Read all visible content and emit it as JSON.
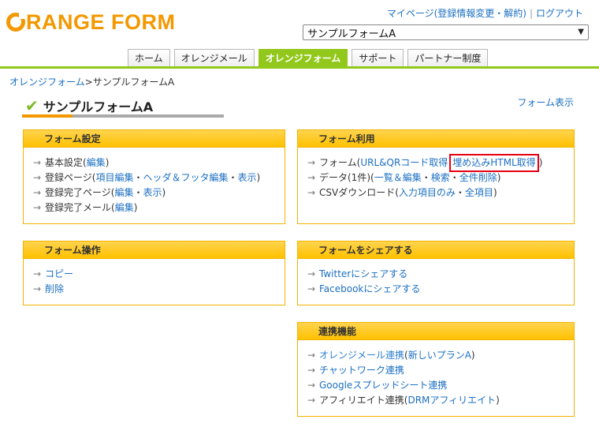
{
  "logo": {
    "text": "RANGE FORM"
  },
  "toplinks": {
    "mypage": "マイページ(登録情報変更・解約)",
    "sep": "|",
    "logout": "ログアウト"
  },
  "form_select": {
    "value": "サンプルフォームA"
  },
  "nav": {
    "tabs": [
      "ホーム",
      "オレンジメール",
      "オレンジフォーム",
      "サポート",
      "パートナー制度"
    ],
    "active_index": 2
  },
  "breadcrumb": {
    "root": "オレンジフォーム",
    "sep": ">",
    "current": "サンプルフォームA"
  },
  "page": {
    "title": "サンプルフォームA",
    "view_link": "フォーム表示"
  },
  "panels": {
    "form_settings": {
      "title": "フォーム設定",
      "rows": [
        {
          "label": "基本設定",
          "open": " (",
          "links": [
            "編集"
          ],
          "close": ")"
        },
        {
          "label": "登録ページ",
          "open": " (",
          "links": [
            "項目編集",
            "ヘッダ＆フッタ編集",
            "表示"
          ],
          "close": ")"
        },
        {
          "label": "登録完了ページ",
          "open": " (",
          "links": [
            "編集",
            "表示"
          ],
          "close": ")"
        },
        {
          "label": "登録完了メール",
          "open": " (",
          "links": [
            "編集"
          ],
          "close": ")"
        }
      ]
    },
    "form_usage": {
      "title": "フォーム利用",
      "row1": {
        "label": "フォーム(",
        "link1": "URL&QRコード取得",
        "link2": "埋め込みHTML取得",
        "close": ")"
      },
      "row2": {
        "label": "データ(1件)",
        "open": " (",
        "link1": "一覧＆編集",
        "link2": "検索",
        "link3": "全件削除",
        "close": ")"
      },
      "row3": {
        "label": "CSVダウンロード(",
        "link1": "入力項目のみ",
        "link2": "全項目",
        "close": ")"
      }
    },
    "form_ops": {
      "title": "フォーム操作",
      "items": [
        "コピー",
        "削除"
      ]
    },
    "share": {
      "title": "フォームをシェアする",
      "items": [
        "Twitterにシェアする",
        "Facebookにシェアする"
      ]
    },
    "integrations": {
      "title": "連携機能",
      "row1": {
        "link1": "オレンジメール連携",
        "open": " (",
        "link2": "新しいプランA",
        "close": ")"
      },
      "row2": {
        "link": "チャットワーク連携"
      },
      "row3": {
        "link": "Googleスプレッドシート連携"
      },
      "row4": {
        "label": "アフィリエイト連携(",
        "link": "DRMアフィリエイト",
        "close": ")"
      }
    }
  },
  "glyphs": {
    "arrow": "→",
    "dot": "・",
    "check": "✔",
    "chevron": "⌄"
  },
  "colors": {
    "brand_orange": "#f39800",
    "nav_green": "#92c81c",
    "panel_yellow": "#ffc100",
    "link_blue": "#1b6fc2",
    "highlight_red": "#e60012"
  }
}
